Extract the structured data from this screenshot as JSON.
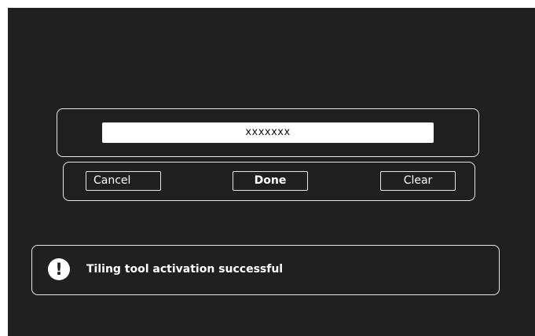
{
  "input": {
    "value": "xxxxxxx"
  },
  "buttons": {
    "cancel": "Cancel",
    "done": "Done",
    "clear": "Clear"
  },
  "toast": {
    "icon": "exclamation-icon",
    "icon_glyph": "!",
    "message": "Tiling tool activation successful"
  },
  "colors": {
    "background": "#202020",
    "border": "#e8e8e8",
    "text": "#ffffff",
    "field": "#ffffff"
  }
}
